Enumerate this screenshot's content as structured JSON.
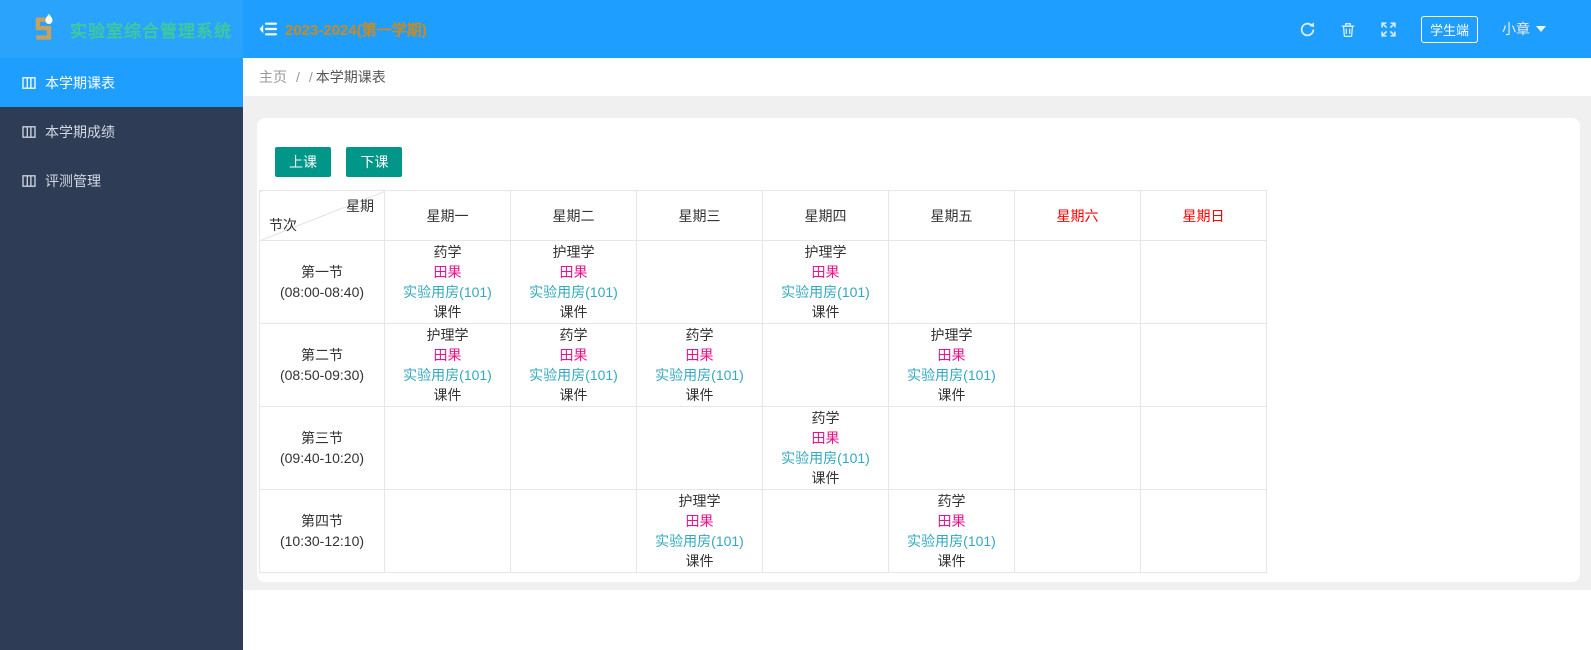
{
  "topbar": {
    "app_title": "实验室综合管理系统",
    "semester_label": "2023-2024(第一学期)",
    "student_badge": "学生端",
    "username": "小章"
  },
  "breadcrumb": {
    "home": "主页",
    "sep1": "/",
    "sep2": "/",
    "current": "本学期课表"
  },
  "sidebar": {
    "items": [
      {
        "label": "本学期课表",
        "active": true
      },
      {
        "label": "本学期成绩",
        "active": false
      },
      {
        "label": "评测管理",
        "active": false
      }
    ]
  },
  "toolbar": {
    "start_class": "上课",
    "end_class": "下课"
  },
  "timetable": {
    "corner": {
      "top_right": "星期",
      "bottom_left": "节次"
    },
    "days": [
      {
        "label": "星期一",
        "weekend": false
      },
      {
        "label": "星期二",
        "weekend": false
      },
      {
        "label": "星期三",
        "weekend": false
      },
      {
        "label": "星期四",
        "weekend": false
      },
      {
        "label": "星期五",
        "weekend": false
      },
      {
        "label": "星期六",
        "weekend": true
      },
      {
        "label": "星期日",
        "weekend": true
      }
    ],
    "periods": [
      {
        "name": "第一节",
        "time": "(08:00-08:40)",
        "cells": [
          {
            "course": "药学",
            "teacher": "田果",
            "room": "实验用房(101)",
            "file": "课件"
          },
          {
            "course": "护理学",
            "teacher": "田果",
            "room": "实验用房(101)",
            "file": "课件"
          },
          null,
          {
            "course": "护理学",
            "teacher": "田果",
            "room": "实验用房(101)",
            "file": "课件"
          },
          null,
          null,
          null
        ]
      },
      {
        "name": "第二节",
        "time": "(08:50-09:30)",
        "cells": [
          {
            "course": "护理学",
            "teacher": "田果",
            "room": "实验用房(101)",
            "file": "课件"
          },
          {
            "course": "药学",
            "teacher": "田果",
            "room": "实验用房(101)",
            "file": "课件"
          },
          {
            "course": "药学",
            "teacher": "田果",
            "room": "实验用房(101)",
            "file": "课件"
          },
          null,
          {
            "course": "护理学",
            "teacher": "田果",
            "room": "实验用房(101)",
            "file": "课件"
          },
          null,
          null
        ]
      },
      {
        "name": "第三节",
        "time": "(09:40-10:20)",
        "cells": [
          null,
          null,
          null,
          {
            "course": "药学",
            "teacher": "田果",
            "room": "实验用房(101)",
            "file": "课件"
          },
          null,
          null,
          null
        ]
      },
      {
        "name": "第四节",
        "time": "(10:30-12:10)",
        "cells": [
          null,
          null,
          {
            "course": "护理学",
            "teacher": "田果",
            "room": "实验用房(101)",
            "file": "课件"
          },
          null,
          {
            "course": "药学",
            "teacher": "田果",
            "room": "实验用房(101)",
            "file": "课件"
          },
          null,
          null
        ]
      }
    ]
  },
  "colors": {
    "topbar_blue": "#1e9fff",
    "sidebar_dark": "#2e3c55",
    "active_item_blue": "#1e9fff",
    "button_teal": "#009688",
    "teacher_pink": "#e6148c",
    "room_cyan": "#33a9bf",
    "weekend_red": "#ff0000",
    "semester_orange": "#ca8a20",
    "app_title_green": "#3fc8a0"
  }
}
